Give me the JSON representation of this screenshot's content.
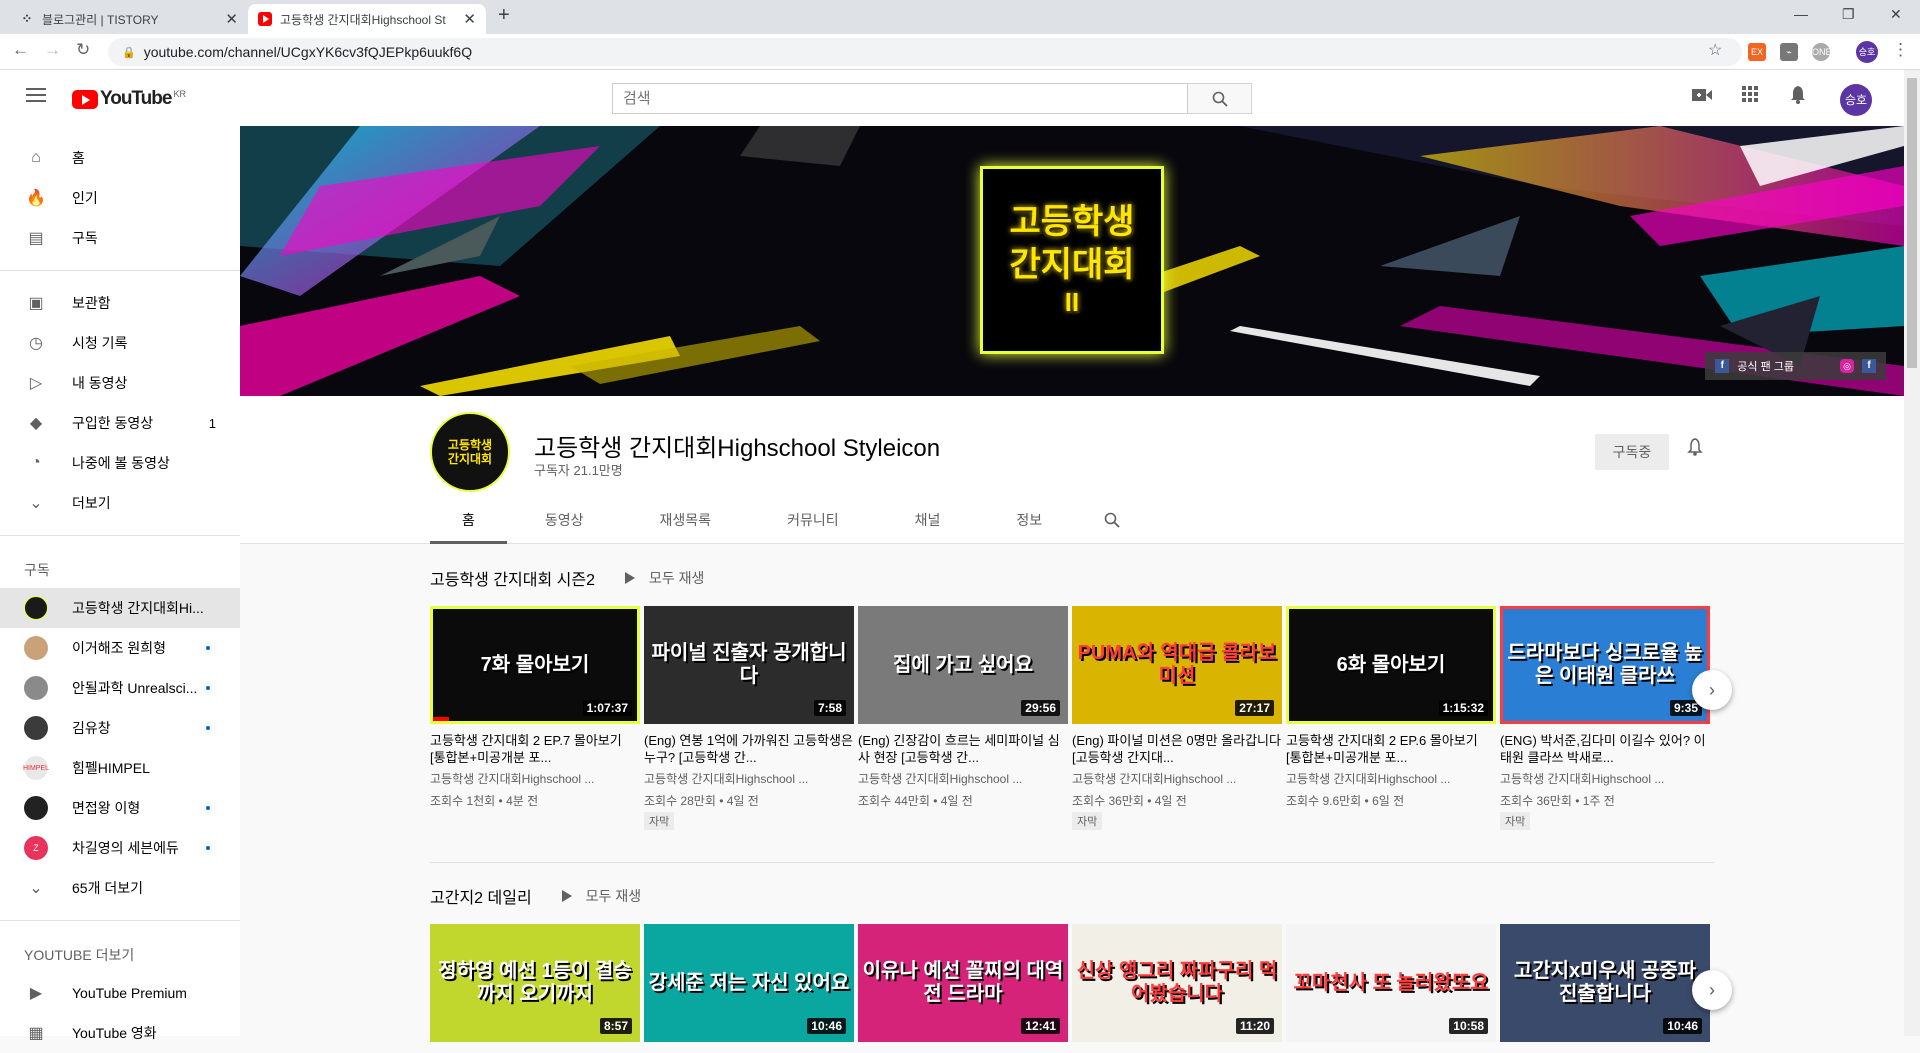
{
  "browser": {
    "tabs": [
      {
        "title": "블로그관리 | TISTORY"
      },
      {
        "title": "고등학생 간지대회Highschool St"
      }
    ],
    "url": "youtube.com/channel/UCgxYK6cv3fQJEPkp6uukf6Q",
    "profile_initials": "승호"
  },
  "header": {
    "logo_text": "YouTube",
    "logo_region": "KR",
    "search_placeholder": "검색",
    "avatar_initials": "승호"
  },
  "sidebar": {
    "main": [
      {
        "label": "홈",
        "icon": "home-icon"
      },
      {
        "label": "인기",
        "icon": "trending-icon"
      },
      {
        "label": "구독",
        "icon": "subscriptions-icon"
      }
    ],
    "library": [
      {
        "label": "보관함",
        "icon": "library-icon"
      },
      {
        "label": "시청 기록",
        "icon": "history-icon"
      },
      {
        "label": "내 동영상",
        "icon": "my-videos-icon"
      },
      {
        "label": "구입한 동영상",
        "icon": "tag-icon",
        "count": "1"
      },
      {
        "label": "나중에 볼 동영상",
        "icon": "watch-later-icon"
      },
      {
        "label": "더보기",
        "icon": "chevron-down-icon"
      }
    ],
    "subs_heading": "구독",
    "subs": [
      {
        "label": "고등학생 간지대회Hi...",
        "color": "#1a1a1a",
        "new": false
      },
      {
        "label": "이거해조 원희형",
        "color": "#c9a27a",
        "new": true
      },
      {
        "label": "안될과학 Unrealsci...",
        "color": "#8a8a8a",
        "new": true
      },
      {
        "label": "김유창",
        "color": "#3b3b3b",
        "new": true
      },
      {
        "label": "힘펠HIMPEL",
        "color": "#e8e8e8",
        "new": false
      },
      {
        "label": "면접왕 이형",
        "color": "#222222",
        "new": true
      },
      {
        "label": "차길영의 세븐에듀",
        "color": "#e8335a",
        "new": true
      }
    ],
    "subs_more": "65개 더보기",
    "more_heading": "YOUTUBE 더보기",
    "more": [
      {
        "label": "YouTube Premium",
        "icon": "youtube-premium-icon"
      },
      {
        "label": "YouTube 영화",
        "icon": "film-icon"
      }
    ]
  },
  "banner": {
    "title_lines": [
      "고등학생",
      "간지대회",
      "II"
    ],
    "link_label": "공식 팬 그룹"
  },
  "channel": {
    "name": "고등학생 간지대회Highschool Styleicon",
    "subscribers": "구독자 21.1만명",
    "subscribe_label": "구독중",
    "tabs": [
      "홈",
      "동영상",
      "재생목록",
      "커뮤니티",
      "채널",
      "정보"
    ]
  },
  "shelves": [
    {
      "title": "고등학생 간지대회 시즌2",
      "play_all": "모두 재생",
      "videos": [
        {
          "thumb_text": "7화 몰아보기",
          "duration": "1:07:37",
          "bg": "#0b0b0b",
          "border": "#e8ff3c",
          "title": "고등학생 간지대회 2 EP.7 몰아보기 [통합본+미공개분 포...",
          "channel": "고등학생 간지대회Highschool ...",
          "meta": "조회수 1천회 • 4분 전",
          "badge": "",
          "progress": 0.08
        },
        {
          "thumb_text": "파이널 진출자 공개합니다",
          "duration": "7:58",
          "bg": "#2c2c2c",
          "border": "#2c2c2c",
          "title": "(Eng) 연봉 1억에 가까워진 고등학생은 누구? [고등학생 간...",
          "channel": "고등학생 간지대회Highschool ...",
          "meta": "조회수 28만회 • 4일 전",
          "badge": "자막",
          "progress": 0
        },
        {
          "thumb_text": "집에 가고 싶어요",
          "duration": "29:56",
          "bg": "#7a7a7a",
          "border": "#7a7a7a",
          "title": "(Eng) 긴장감이 흐르는 세미파이널 심사 현장 [고등학생 간...",
          "channel": "고등학생 간지대회Highschool ...",
          "meta": "조회수 44만회 • 4일 전",
          "badge": "",
          "progress": 0
        },
        {
          "thumb_text": "PUMA와 역대급 콜라보 미션",
          "duration": "27:17",
          "bg": "#d9b400",
          "border": "#d9b400",
          "title": "(Eng) 파이널 미션은 0명만 올라갑니다 [고등학생 간지대...",
          "channel": "고등학생 간지대회Highschool ...",
          "meta": "조회수 36만회 • 4일 전",
          "badge": "자막",
          "progress": 0
        },
        {
          "thumb_text": "6화 몰아보기",
          "duration": "1:15:32",
          "bg": "#0b0b0b",
          "border": "#e8ff3c",
          "title": "고등학생 간지대회 2 EP.6 몰아보기 [통합본+미공개분 포...",
          "channel": "고등학생 간지대회Highschool ...",
          "meta": "조회수 9.6만회 • 6일 전",
          "badge": "",
          "progress": 0
        },
        {
          "thumb_text": "드라마보다 싱크로율 높은 이태원 클라쓰",
          "duration": "9:35",
          "bg": "#2a7fd4",
          "border": "#ff3b3b",
          "title": "(ENG) 박서준,김다미 이길수 있어? 이태원 클라쓰 박새로...",
          "channel": "고등학생 간지대회Highschool ...",
          "meta": "조회수 36만회 • 1주 전",
          "badge": "자막",
          "progress": 0
        }
      ]
    },
    {
      "title": "고간지2 데일리",
      "play_all": "모두 재생",
      "videos": [
        {
          "thumb_text": "정하영 예선 1등이 결승까지 오기까지",
          "duration": "8:57",
          "bg": "#c1d72e",
          "border": "#c1d72e"
        },
        {
          "thumb_text": "강세준 저는 자신 있어요",
          "duration": "10:46",
          "bg": "#0aa6a0",
          "border": "#0aa6a0"
        },
        {
          "thumb_text": "이유나 예선 꼴찌의 대역전 드라마",
          "duration": "12:41",
          "bg": "#d6237a",
          "border": "#d6237a"
        },
        {
          "thumb_text": "신상 앵그리 짜파구리 먹어봤습니다",
          "duration": "11:20",
          "bg": "#f2efe6",
          "border": "#f2efe6"
        },
        {
          "thumb_text": "꼬마천사 또 놀러왔또요",
          "duration": "10:58",
          "bg": "#f4f4f4",
          "border": "#f4f4f4"
        },
        {
          "thumb_text": "고간지x미우새 공중파 진출합니다",
          "duration": "10:46",
          "bg": "#3a4a6b",
          "border": "#3a4a6b"
        }
      ]
    }
  ]
}
